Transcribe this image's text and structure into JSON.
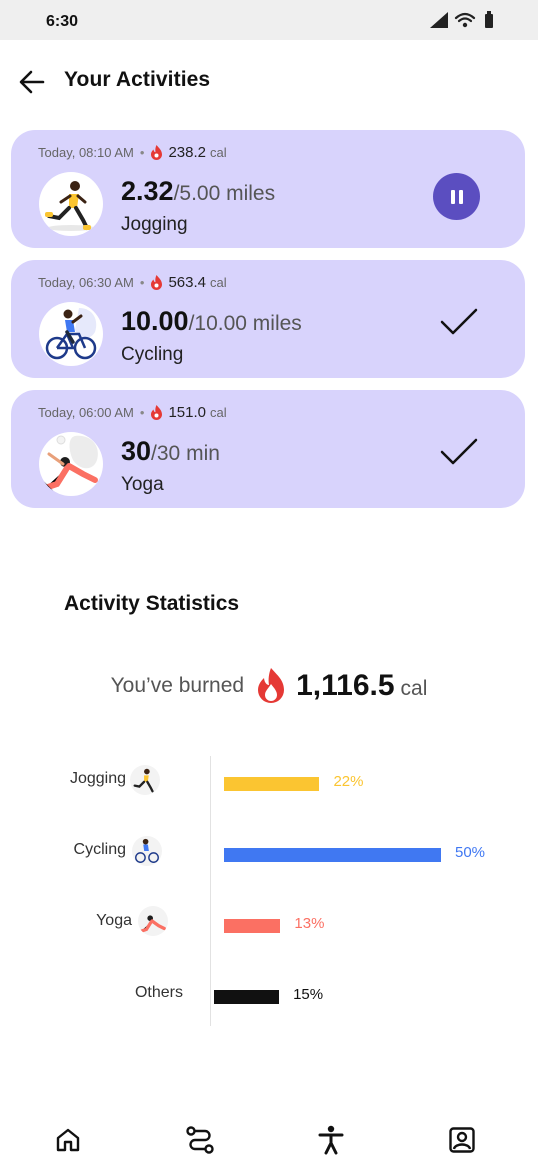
{
  "status_bar": {
    "time": "6:30"
  },
  "header": {
    "title": "Your Activities"
  },
  "activities": [
    {
      "meta_time": "Today, 08:10 AM",
      "calories": "238.2",
      "cal_unit": "cal",
      "current": "2.32",
      "target": "/5.00 miles",
      "name": "Jogging",
      "state": "pause-icon"
    },
    {
      "meta_time": "Today, 06:30 AM",
      "calories": "563.4",
      "cal_unit": "cal",
      "current": "10.00",
      "target": "/10.00 miles",
      "name": "Cycling",
      "state": "check-icon"
    },
    {
      "meta_time": "Today, 06:00 AM",
      "calories": "151.0",
      "cal_unit": "cal",
      "current": "30",
      "target": "/30 min",
      "name": "Yoga",
      "state": "check-icon"
    }
  ],
  "stats": {
    "title": "Activity Statistics",
    "burned_prefix": "You’ve burned",
    "burned_total": "1,116.5",
    "burned_unit": "cal"
  },
  "chart_data": {
    "type": "bar",
    "categories": [
      "Jogging",
      "Cycling",
      "Yoga",
      "Others"
    ],
    "values": [
      22,
      50,
      13,
      15
    ],
    "value_labels": [
      "22%",
      "50%",
      "13%",
      "15%"
    ],
    "colors": [
      "#fbc531",
      "#4078f2",
      "#fb7063",
      "#111111"
    ],
    "orientation": "horizontal"
  },
  "colors": {
    "card": "#d8d3fc",
    "accent": "#5b4ec0",
    "flame": "#e53935"
  },
  "nav": [
    "home-icon",
    "route-icon",
    "activity-icon",
    "profile-icon"
  ]
}
